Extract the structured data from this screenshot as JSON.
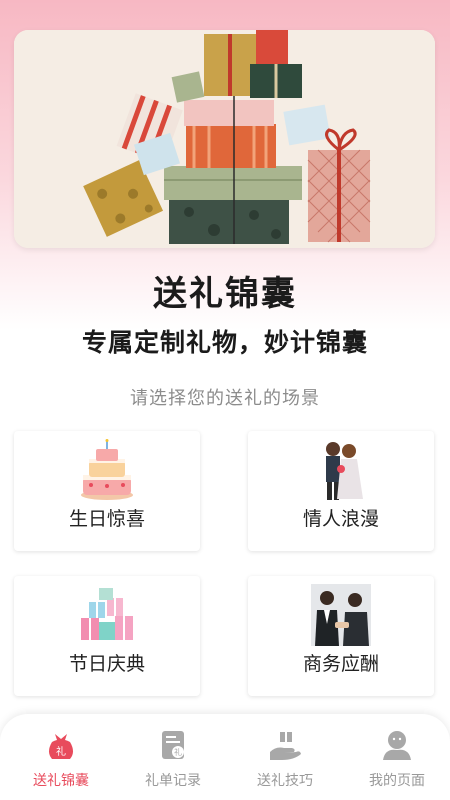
{
  "hero": {
    "image": "gift-boxes-illustration"
  },
  "header": {
    "title": "送礼锦囊",
    "subtitle": "专属定制礼物，妙计锦囊",
    "prompt": "请选择您的送礼的场景"
  },
  "scenes": [
    {
      "label": "生日惊喜",
      "icon": "birthday-cake-icon"
    },
    {
      "label": "情人浪漫",
      "icon": "couple-icon"
    },
    {
      "label": "节日庆典",
      "icon": "gift-pile-icon"
    },
    {
      "label": "商务应酬",
      "icon": "business-handshake-icon"
    }
  ],
  "nav": {
    "active_color": "#e84b5c",
    "inactive_color": "#999999",
    "items": [
      {
        "label": "送礼锦囊",
        "icon": "gift-bag-icon",
        "active": true
      },
      {
        "label": "礼单记录",
        "icon": "document-icon",
        "active": false
      },
      {
        "label": "送礼技巧",
        "icon": "hand-gift-icon",
        "active": false
      },
      {
        "label": "我的页面",
        "icon": "user-icon",
        "active": false
      }
    ]
  }
}
